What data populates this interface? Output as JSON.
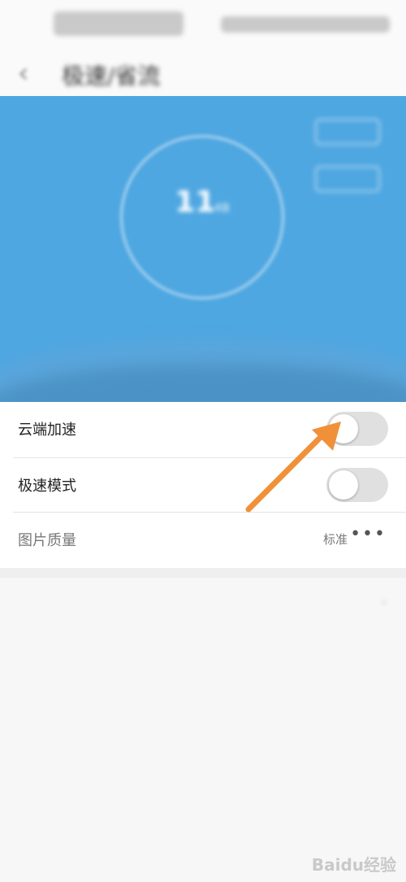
{
  "status_bar": {
    "left_text": "",
    "right_text": ""
  },
  "titlebar": {
    "back_icon": "chevron-left-icon",
    "title": "极速/省流"
  },
  "hero": {
    "circle_line1": "",
    "circle_line2": "",
    "circle_value": "11",
    "circle_unit": "KB",
    "btn_top": "",
    "btn_bottom": "",
    "stat_left": "",
    "stat_right": "",
    "color": "#4fa7e1"
  },
  "settings": {
    "cloud_accel": {
      "label": "云端加速",
      "on": false
    },
    "speed_mode": {
      "label": "极速模式",
      "on": false
    },
    "image_quality": {
      "label": "图片质量",
      "value": "标准",
      "more_icon": "more-dots-icon"
    }
  },
  "blurred_row": {
    "title": "",
    "subtitle": "",
    "right_value": "",
    "right_icon": "chevron-right-icon"
  },
  "annotation": {
    "color": "#f0913a"
  },
  "watermark": {
    "text": "Baidu经验"
  }
}
